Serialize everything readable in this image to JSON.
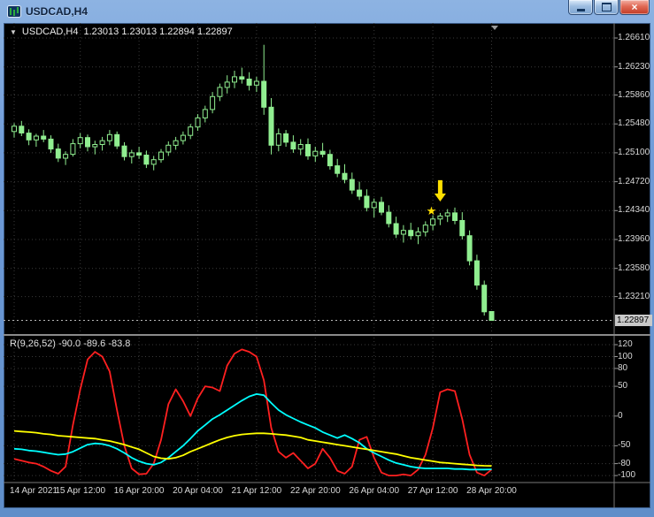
{
  "window": {
    "title": "USDCAD,H4",
    "controls": {
      "minimize": "minimize",
      "maximize": "maximize",
      "close": "close",
      "close_glyph": "×"
    }
  },
  "colors": {
    "frame": "#6f9bd8",
    "background": "#000000",
    "grid": "#3a3a3a",
    "candle": "#90EE90",
    "bull_fill": "#000000",
    "axis_text": "#D8D8D8",
    "price_tag_bg": "#C9C9C9",
    "marker": "#FFE000",
    "red": "#FF2020",
    "cyan": "#00FFFF",
    "yellow": "#FFFF00"
  },
  "chart": {
    "collapse_glyph": "▼",
    "header_symbol": "USDCAD,H4",
    "header_ohlc": "1.23013 1.23013 1.22894 1.22897",
    "current_price_label": "1.22897"
  },
  "indicator": {
    "label": "R(9,26,52) -90.0 -89.6 -83.8"
  },
  "chart_data": {
    "type": "candlestick",
    "symbol": "USDCAD",
    "timeframe": "H4",
    "current_price": 1.22897,
    "price_axis_ticks": [
      {
        "label": "1.26610",
        "value": 1.2661
      },
      {
        "label": "1.26230",
        "value": 1.2623
      },
      {
        "label": "1.25860",
        "value": 1.2586
      },
      {
        "label": "1.25480",
        "value": 1.2548
      },
      {
        "label": "1.25100",
        "value": 1.251
      },
      {
        "label": "1.24720",
        "value": 1.2472
      },
      {
        "label": "1.24340",
        "value": 1.2434
      },
      {
        "label": "1.23960",
        "value": 1.2396
      },
      {
        "label": "1.23580",
        "value": 1.2358
      },
      {
        "label": "1.23210",
        "value": 1.2321
      }
    ],
    "time_axis_ticks": [
      {
        "label": "14 Apr 2021",
        "index": 0
      },
      {
        "label": "15 Apr 12:00",
        "index": 9
      },
      {
        "label": "16 Apr 20:00",
        "index": 17
      },
      {
        "label": "20 Apr 04:00",
        "index": 25
      },
      {
        "label": "21 Apr 12:00",
        "index": 33
      },
      {
        "label": "22 Apr 20:00",
        "index": 41
      },
      {
        "label": "26 Apr 04:00",
        "index": 49
      },
      {
        "label": "27 Apr 12:00",
        "index": 57
      },
      {
        "label": "28 Apr 20:00",
        "index": 65
      }
    ],
    "candles_ohlc": [
      [
        1.2538,
        1.2549,
        1.253,
        1.2545
      ],
      [
        1.2545,
        1.2552,
        1.2532,
        1.2536
      ],
      [
        1.2536,
        1.2541,
        1.252,
        1.2527
      ],
      [
        1.2527,
        1.2535,
        1.2518,
        1.2532
      ],
      [
        1.2532,
        1.254,
        1.2524,
        1.2528
      ],
      [
        1.2528,
        1.2533,
        1.251,
        1.2515
      ],
      [
        1.2515,
        1.2522,
        1.2498,
        1.2503
      ],
      [
        1.2503,
        1.2512,
        1.2494,
        1.2508
      ],
      [
        1.2508,
        1.2528,
        1.2505,
        1.2522
      ],
      [
        1.2522,
        1.2536,
        1.2516,
        1.253
      ],
      [
        1.253,
        1.2534,
        1.2512,
        1.2518
      ],
      [
        1.2518,
        1.2526,
        1.2508,
        1.2521
      ],
      [
        1.2521,
        1.2531,
        1.2513,
        1.2526
      ],
      [
        1.2526,
        1.254,
        1.252,
        1.2534
      ],
      [
        1.2534,
        1.2538,
        1.2515,
        1.2519
      ],
      [
        1.2519,
        1.2524,
        1.25,
        1.2505
      ],
      [
        1.2505,
        1.2514,
        1.2496,
        1.251
      ],
      [
        1.251,
        1.2518,
        1.2502,
        1.2507
      ],
      [
        1.2507,
        1.2513,
        1.249,
        1.2495
      ],
      [
        1.2495,
        1.2506,
        1.2487,
        1.2501
      ],
      [
        1.2501,
        1.2515,
        1.2497,
        1.2511
      ],
      [
        1.2511,
        1.2525,
        1.2506,
        1.252
      ],
      [
        1.252,
        1.2531,
        1.2514,
        1.2526
      ],
      [
        1.2526,
        1.2538,
        1.2521,
        1.2533
      ],
      [
        1.2533,
        1.2548,
        1.2528,
        1.2544
      ],
      [
        1.2544,
        1.2561,
        1.2539,
        1.2556
      ],
      [
        1.2556,
        1.2572,
        1.255,
        1.2567
      ],
      [
        1.2567,
        1.259,
        1.2562,
        1.2584
      ],
      [
        1.2584,
        1.2601,
        1.2578,
        1.2596
      ],
      [
        1.2596,
        1.2612,
        1.2588,
        1.2603
      ],
      [
        1.2603,
        1.2618,
        1.2595,
        1.261
      ],
      [
        1.261,
        1.2622,
        1.2601,
        1.2607
      ],
      [
        1.2607,
        1.2616,
        1.2592,
        1.2599
      ],
      [
        1.2599,
        1.261,
        1.259,
        1.2604
      ],
      [
        1.2604,
        1.2652,
        1.256,
        1.257
      ],
      [
        1.257,
        1.2582,
        1.2508,
        1.252
      ],
      [
        1.252,
        1.2542,
        1.2512,
        1.2535
      ],
      [
        1.2535,
        1.254,
        1.2518,
        1.2524
      ],
      [
        1.2524,
        1.2533,
        1.251,
        1.2515
      ],
      [
        1.2515,
        1.2528,
        1.2507,
        1.2521
      ],
      [
        1.2521,
        1.2529,
        1.2501,
        1.2506
      ],
      [
        1.2506,
        1.2518,
        1.2498,
        1.2512
      ],
      [
        1.2512,
        1.2523,
        1.2504,
        1.2508
      ],
      [
        1.2508,
        1.2514,
        1.2488,
        1.2493
      ],
      [
        1.2493,
        1.2502,
        1.2478,
        1.2483
      ],
      [
        1.2483,
        1.2495,
        1.247,
        1.2475
      ],
      [
        1.2475,
        1.2484,
        1.2456,
        1.2461
      ],
      [
        1.2461,
        1.2472,
        1.2448,
        1.2453
      ],
      [
        1.2453,
        1.2462,
        1.2433,
        1.2438
      ],
      [
        1.2438,
        1.245,
        1.2425,
        1.2445
      ],
      [
        1.2445,
        1.2452,
        1.2428,
        1.2432
      ],
      [
        1.2432,
        1.2441,
        1.2412,
        1.2417
      ],
      [
        1.2417,
        1.2426,
        1.2398,
        1.2403
      ],
      [
        1.2403,
        1.2415,
        1.2392,
        1.2408
      ],
      [
        1.2408,
        1.2418,
        1.2396,
        1.2401
      ],
      [
        1.2401,
        1.2412,
        1.239,
        1.2406
      ],
      [
        1.2406,
        1.242,
        1.24,
        1.2415
      ],
      [
        1.2415,
        1.2428,
        1.2408,
        1.2423
      ],
      [
        1.2423,
        1.2431,
        1.2415,
        1.2427
      ],
      [
        1.2427,
        1.2436,
        1.2419,
        1.2431
      ],
      [
        1.2431,
        1.2438,
        1.2416,
        1.2421
      ],
      [
        1.2421,
        1.2432,
        1.2396,
        1.2401
      ],
      [
        1.2401,
        1.2408,
        1.2362,
        1.2368
      ],
      [
        1.2368,
        1.2376,
        1.233,
        1.2336
      ],
      [
        1.2336,
        1.2342,
        1.2296,
        1.2301
      ],
      [
        1.23013,
        1.23013,
        1.22894,
        1.22897
      ]
    ],
    "markers": [
      {
        "type": "star",
        "index": 56.8,
        "price": 1.2433,
        "glyph": "★"
      },
      {
        "type": "down-arrow",
        "index": 58,
        "price_top": 1.2474,
        "price_bottom": 1.2446
      }
    ],
    "indicator_pane": {
      "name": "R(9,26,52)",
      "values_label": "-90.0 -89.6 -83.8",
      "axis_ticks": [
        {
          "label": "120",
          "value": 120
        },
        {
          "label": "100",
          "value": 100
        },
        {
          "label": "80",
          "value": 80
        },
        {
          "label": "50",
          "value": 50
        },
        {
          "label": "0",
          "value": 0
        },
        {
          "label": "-50",
          "value": -50
        },
        {
          "label": "-80",
          "value": -80
        },
        {
          "label": "-100",
          "value": -100
        }
      ],
      "series": [
        {
          "name": "R9",
          "color": "#FF2020",
          "values": [
            -72,
            -75,
            -78,
            -80,
            -85,
            -92,
            -97,
            -85,
            -15,
            45,
            95,
            108,
            100,
            75,
            10,
            -50,
            -88,
            -98,
            -97,
            -80,
            -40,
            20,
            45,
            25,
            0,
            30,
            50,
            48,
            42,
            85,
            105,
            112,
            108,
            100,
            60,
            -20,
            -60,
            -70,
            -62,
            -75,
            -88,
            -80,
            -55,
            -70,
            -92,
            -97,
            -85,
            -40,
            -35,
            -70,
            -95,
            -100,
            -100,
            -98,
            -100,
            -90,
            -65,
            -20,
            40,
            45,
            42,
            -5,
            -65,
            -95,
            -100,
            -90
          ]
        },
        {
          "name": "R26",
          "color": "#00FFFF",
          "values": [
            -55,
            -56,
            -58,
            -59,
            -61,
            -63,
            -65,
            -64,
            -60,
            -54,
            -48,
            -46,
            -47,
            -50,
            -55,
            -62,
            -70,
            -76,
            -80,
            -82,
            -78,
            -70,
            -60,
            -50,
            -38,
            -25,
            -15,
            -5,
            2,
            10,
            18,
            26,
            33,
            37,
            35,
            22,
            10,
            2,
            -4,
            -10,
            -15,
            -20,
            -27,
            -32,
            -37,
            -32,
            -38,
            -45,
            -55,
            -62,
            -68,
            -74,
            -79,
            -82,
            -85,
            -87,
            -88,
            -88,
            -88,
            -88,
            -89,
            -89,
            -90,
            -90,
            -90,
            -89.6
          ]
        },
        {
          "name": "R52",
          "color": "#FFFF00",
          "values": [
            -25,
            -26,
            -27,
            -28,
            -30,
            -31,
            -33,
            -34,
            -35,
            -36,
            -37,
            -38,
            -40,
            -42,
            -45,
            -48,
            -52,
            -56,
            -62,
            -68,
            -71,
            -72,
            -70,
            -66,
            -60,
            -55,
            -50,
            -45,
            -40,
            -36,
            -33,
            -31,
            -30,
            -29,
            -29,
            -30,
            -31,
            -32,
            -34,
            -36,
            -40,
            -42,
            -44,
            -46,
            -48,
            -50,
            -52,
            -54,
            -56,
            -58,
            -60,
            -62,
            -64,
            -67,
            -70,
            -72,
            -74,
            -76,
            -78,
            -79,
            -80,
            -81,
            -82,
            -83,
            -83.5,
            -83.8
          ]
        }
      ]
    }
  }
}
